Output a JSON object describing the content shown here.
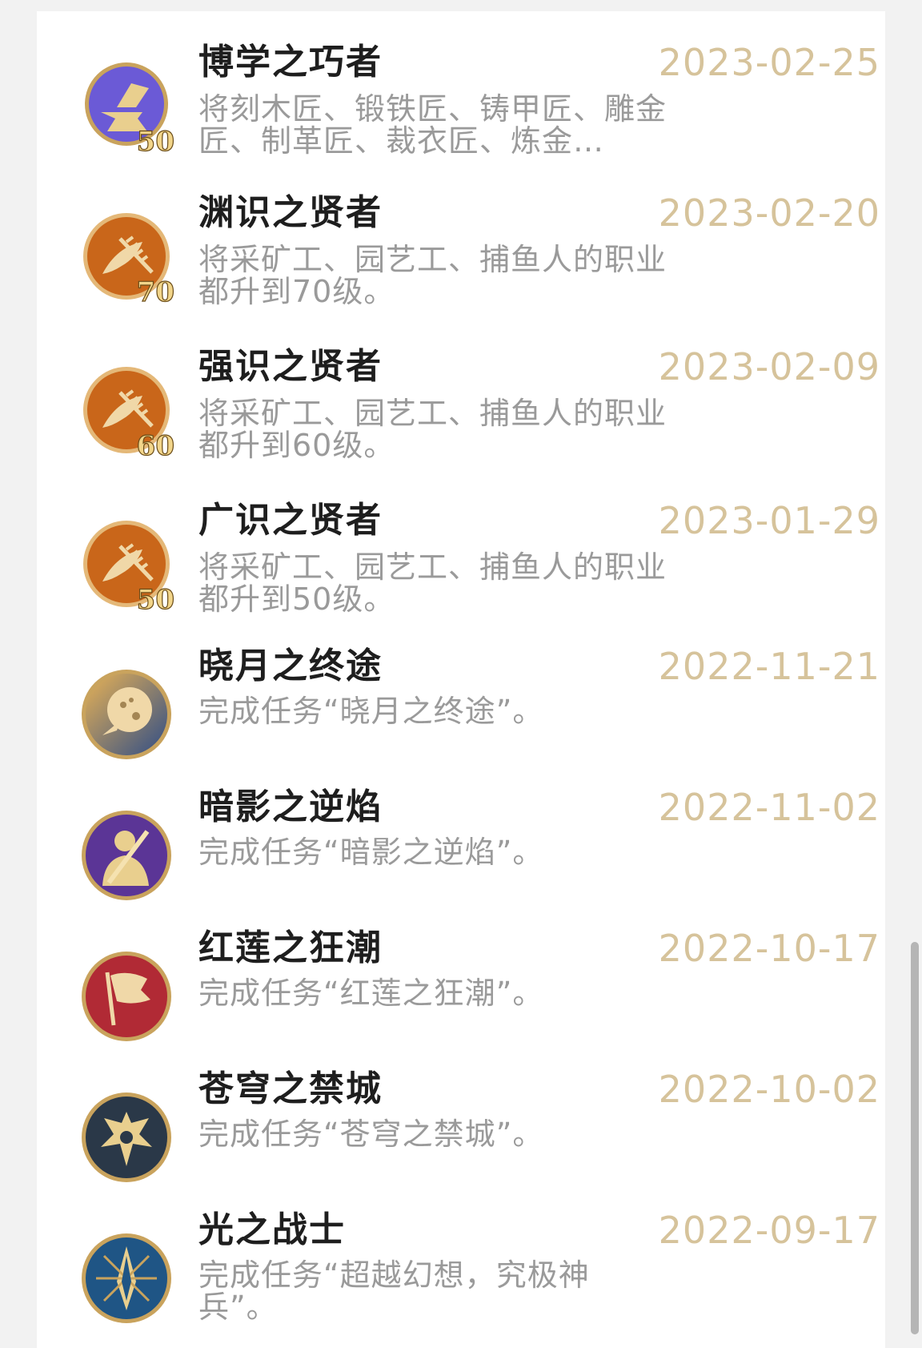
{
  "achievements": [
    {
      "title": "博学之巧者",
      "desc": "将刻木匠、锻铁匠、铸甲匠、雕金匠、制革匠、裁衣匠、炼金…",
      "date": "2023-02-25",
      "level": "50",
      "icon": "anvil-icon",
      "color": "#6b5ad6"
    },
    {
      "title": "渊识之贤者",
      "desc": "将采矿工、园艺工、捕鱼人的职业都升到70级。",
      "date": "2023-02-20",
      "level": "70",
      "icon": "fish-wheat-icon",
      "color": "#c9661a"
    },
    {
      "title": "强识之贤者",
      "desc": "将采矿工、园艺工、捕鱼人的职业都升到60级。",
      "date": "2023-02-09",
      "level": "60",
      "icon": "fish-wheat-icon",
      "color": "#c9661a"
    },
    {
      "title": "广识之贤者",
      "desc": "将采矿工、园艺工、捕鱼人的职业都升到50级。",
      "date": "2023-01-29",
      "level": "50",
      "icon": "fish-wheat-icon",
      "color": "#c9661a"
    },
    {
      "title": "晓月之终途",
      "desc": "完成任务“晓月之终途”。",
      "date": "2022-11-21",
      "level": "",
      "icon": "moon-icon",
      "color": "#3e5a8a"
    },
    {
      "title": "暗影之逆焰",
      "desc": "完成任务“暗影之逆焰”。",
      "date": "2022-11-02",
      "level": "",
      "icon": "warrior-icon",
      "color": "#5b3596"
    },
    {
      "title": "红莲之狂潮",
      "desc": "完成任务“红莲之狂潮”。",
      "date": "2022-10-17",
      "level": "",
      "icon": "banner-icon",
      "color": "#b12a35"
    },
    {
      "title": "苍穹之禁城",
      "desc": "完成任务“苍穹之禁城”。",
      "date": "2022-10-02",
      "level": "",
      "icon": "dragon-icon",
      "color": "#2a3848"
    },
    {
      "title": "光之战士",
      "desc": "完成任务“超越幻想，究极神兵”。",
      "date": "2022-09-17",
      "level": "",
      "icon": "crystal-icon",
      "color": "#1f5585"
    }
  ]
}
